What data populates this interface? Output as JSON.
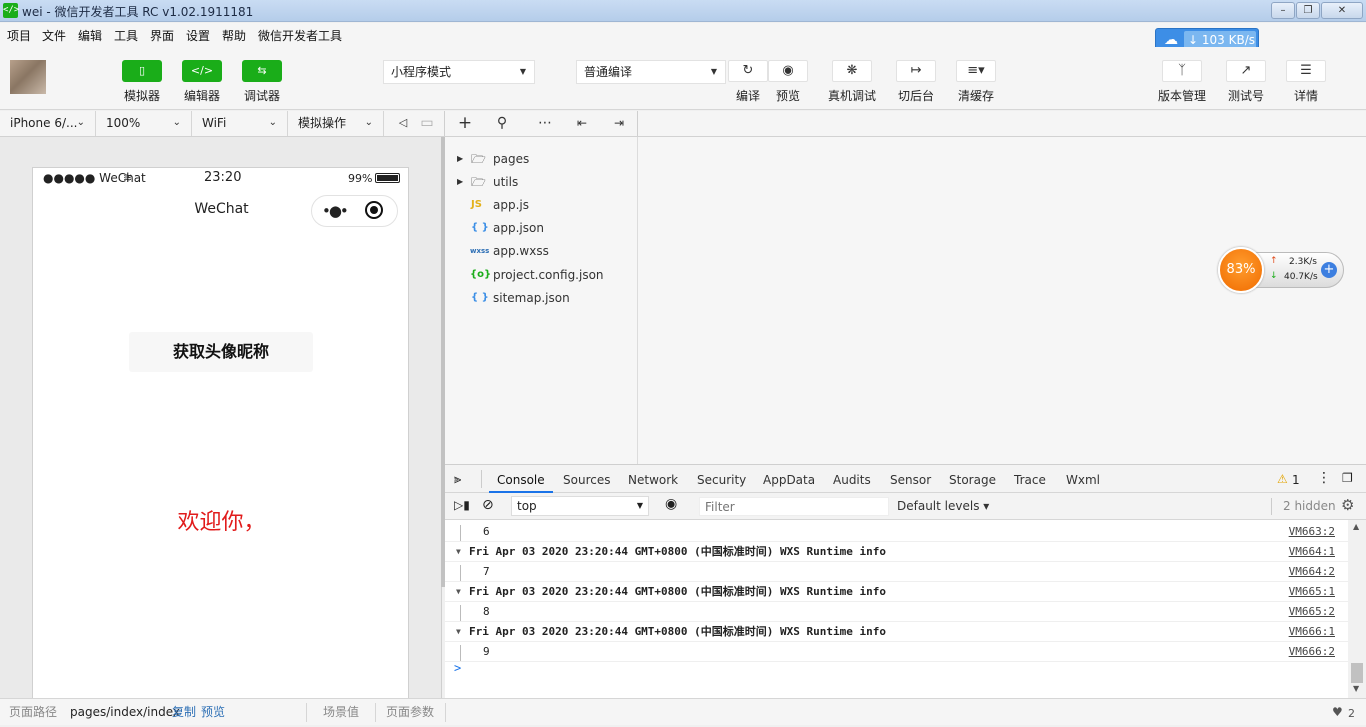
{
  "window": {
    "title": "wei - 微信开发者工具 RC v1.02.1911181",
    "icon_glyph": "</>"
  },
  "menu": [
    "项目",
    "文件",
    "编辑",
    "工具",
    "界面",
    "设置",
    "帮助",
    "微信开发者工具"
  ],
  "speed_widget": {
    "value": "103 KB/s"
  },
  "toolbar": {
    "simulator_label": "模拟器",
    "editor_label": "编辑器",
    "debugger_label": "调试器",
    "mode_select": "小程序模式",
    "compile_select": "普通编译",
    "compile_label": "编译",
    "preview_label": "预览",
    "remote_debug_label": "真机调试",
    "background_label": "切后台",
    "clear_cache_label": "清缓存",
    "version_label": "版本管理",
    "test_label": "测试号",
    "details_label": "详情"
  },
  "subbar": {
    "device": "iPhone 6/...",
    "zoom": "100%",
    "network": "WiFi",
    "simulate": "模拟操作"
  },
  "phone": {
    "carrier": "●●●●● WeChat",
    "time": "23:20",
    "battery": "99%",
    "nav_title": "WeChat",
    "button_label": "获取头像昵称",
    "welcome": "欢迎你，"
  },
  "file_tree": [
    {
      "name": "pages",
      "type": "folder"
    },
    {
      "name": "utils",
      "type": "folder"
    },
    {
      "name": "app.js",
      "type": "js",
      "icon_text": "JS"
    },
    {
      "name": "app.json",
      "type": "json",
      "icon_text": "{ }"
    },
    {
      "name": "app.wxss",
      "type": "wxss",
      "icon_text": "wxss"
    },
    {
      "name": "project.config.json",
      "type": "config",
      "icon_text": "{o}"
    },
    {
      "name": "sitemap.json",
      "type": "json",
      "icon_text": "{ }"
    }
  ],
  "devtools": {
    "tabs": [
      "Console",
      "Sources",
      "Network",
      "Security",
      "AppData",
      "Audits",
      "Sensor",
      "Storage",
      "Trace",
      "Wxml"
    ],
    "active_tab": "Console",
    "warnings": "1",
    "context": "top",
    "filter_placeholder": "Filter",
    "levels": "Default levels",
    "hidden": "2 hidden"
  },
  "console": {
    "rows": [
      {
        "kind": "value",
        "text": "6",
        "src": "VM663:2"
      },
      {
        "kind": "info",
        "text": "Fri Apr 03 2020 23:20:44 GMT+0800 (中国标准时间) WXS Runtime info",
        "src": "VM664:1"
      },
      {
        "kind": "value",
        "text": "7",
        "src": "VM664:2"
      },
      {
        "kind": "info",
        "text": "Fri Apr 03 2020 23:20:44 GMT+0800 (中国标准时间) WXS Runtime info",
        "src": "VM665:1"
      },
      {
        "kind": "value",
        "text": "8",
        "src": "VM665:2"
      },
      {
        "kind": "info",
        "text": "Fri Apr 03 2020 23:20:44 GMT+0800 (中国标准时间) WXS Runtime info",
        "src": "VM666:1"
      },
      {
        "kind": "value",
        "text": "9",
        "src": "VM666:2"
      }
    ],
    "prompt": ">"
  },
  "status": {
    "path_label": "页面路径",
    "path": "pages/index/index",
    "copy": "复制",
    "preview": "预览",
    "scene": "场景值",
    "params": "页面参数",
    "notifications": "2"
  },
  "float_ball": {
    "percent": "83%",
    "up": "2.3K/s",
    "down": "40.7K/s"
  },
  "colors": {
    "green": "#1aad19",
    "welcome_red": "#e11b1b",
    "tab_blue": "#1a73e8"
  }
}
